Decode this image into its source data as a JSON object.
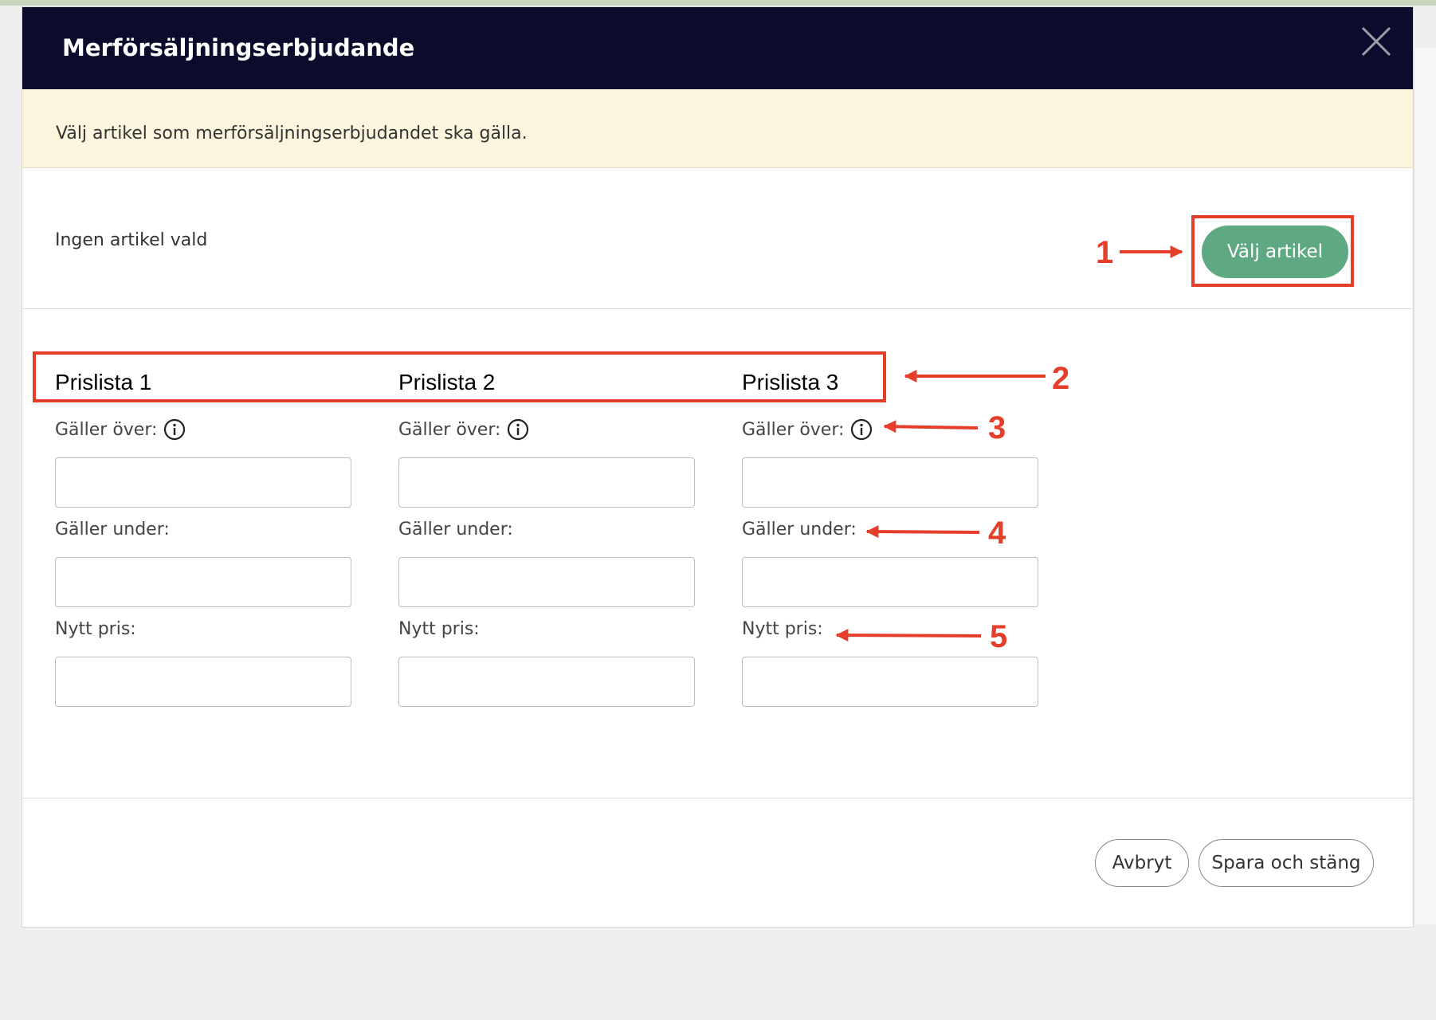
{
  "dialog": {
    "title": "Merförsäljningserbjudande",
    "close_label": "Stäng",
    "notice": "Välj artikel som merförsäljningserbjudandet ska gälla.",
    "article_status": "Ingen artikel vald",
    "select_article_label": "Välj artikel"
  },
  "price_lists": [
    {
      "title": "Prislista 1",
      "applies_over_label": "Gäller över:",
      "applies_under_label": "Gäller under:",
      "new_price_label": "Nytt pris:",
      "applies_over_value": "",
      "applies_under_value": "",
      "new_price_value": ""
    },
    {
      "title": "Prislista 2",
      "applies_over_label": "Gäller över:",
      "applies_under_label": "Gäller under:",
      "new_price_label": "Nytt pris:",
      "applies_over_value": "",
      "applies_under_value": "",
      "new_price_value": ""
    },
    {
      "title": "Prislista 3",
      "applies_over_label": "Gäller över:",
      "applies_under_label": "Gäller under:",
      "new_price_label": "Nytt pris:",
      "applies_over_value": "",
      "applies_under_value": "",
      "new_price_value": ""
    }
  ],
  "footer": {
    "cancel_label": "Avbryt",
    "save_close_label": "Spara och stäng"
  },
  "annotations": [
    "1",
    "2",
    "3",
    "4",
    "5"
  ],
  "colors": {
    "header_bg": "#0b0c2b",
    "notice_bg": "#fbf5dd",
    "primary_button": "#5fa982",
    "annotation": "#e53e2b"
  },
  "icons": [
    "close-icon",
    "info-icon"
  ]
}
